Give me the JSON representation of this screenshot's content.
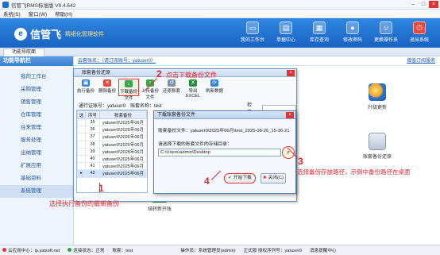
{
  "window": {
    "title": "信管飞RMS标准版 V9.4.642"
  },
  "menu": [
    "系统(S)",
    "窗口(W)",
    "帮助(H)"
  ],
  "brand": {
    "name": "信管飞",
    "slogan": "精细化管理软件"
  },
  "topnav": [
    {
      "label": "我的工作台",
      "icon": "desk-icon"
    },
    {
      "label": "单据中心",
      "icon": "docs-icon"
    },
    {
      "label": "库存查询",
      "icon": "stock-icon"
    },
    {
      "label": "修改密码",
      "icon": "lock-icon"
    },
    {
      "label": "更换操作员",
      "icon": "user-icon"
    },
    {
      "label": "退出系统",
      "icon": "power-icon"
    }
  ],
  "tab": "功能导航面",
  "sidebar": {
    "title": "功能导航栏",
    "items": [
      "我的工作台",
      "采购管理",
      "销售管理",
      "仓库管理",
      "往来管理",
      "服务处理",
      "出纳管理",
      "扩展应用",
      "基础资料",
      "系统管理"
    ]
  },
  "main": {
    "breadcrumb": "云套账名：（请订阅账号：yatuser0）",
    "right_link": "增值订阅服务",
    "tiles": [
      {
        "label": "升级更新",
        "icon": "globe-icon"
      },
      {
        "label": "账套备份还原",
        "icon": "database-icon"
      },
      {
        "label": "结转新开账",
        "icon": "refresh-icon"
      }
    ]
  },
  "backup": {
    "title": "账套备份还原",
    "toolbar": [
      "执行备份",
      "删除备份",
      "下载备份文件",
      "上传备份文件",
      "还原账套",
      "导出EXCEL",
      "刷新数据"
    ],
    "filter": {
      "account_label": "通行证账号：",
      "account": "yatuser0",
      "set_label": "账套名称：",
      "set": "test",
      "search_label": "检索："
    },
    "columns": [
      "选",
      "序号",
      "账套备份"
    ],
    "rows": [
      {
        "no": "35",
        "name": "yatuser0\\2025年06月"
      },
      {
        "no": "36",
        "name": "yatuser0\\2025年06月"
      },
      {
        "no": "37",
        "name": "yatuser0\\2025年06月"
      },
      {
        "no": "38",
        "name": "yatuser0\\2025年06月"
      },
      {
        "no": "39",
        "name": "yatuser0\\2025年06月"
      },
      {
        "no": "40",
        "name": "yatuser0\\2025年06月"
      },
      {
        "no": "41",
        "name": "yatuser0\\2025年06月"
      },
      {
        "no": "42",
        "name": "yatuser0\\2025年06月"
      }
    ],
    "selected_row": 7
  },
  "dialog": {
    "title": "下载账套备份文件",
    "file_label": "账套备份文件：yatuser0\\2025年06月\\test_2025-06-26_15-36-21",
    "dir_label": "请选择下载的账套文件的存储目录：",
    "path": "C:\\Users\\admin\\Desktop",
    "start": "开始下载",
    "close": "关闭(C)"
  },
  "annotations": {
    "n1": "1",
    "t1": "选择执行备份的最新备份",
    "n2": "2",
    "t2": "点击下载备份文件",
    "n3": "3",
    "t3a": "选择备份存放路径，示例中备份路径在桌面",
    "n4": "4"
  },
  "status": {
    "cloud": "云应用中心：ip.yatsoft.net",
    "conn": "连接状态：正常",
    "set": "账套：test",
    "operator": "操作员：系统管理员(admin)",
    "edition": "正式版 授权序列号：yatuser0",
    "msg": "消息提醒中心"
  }
}
